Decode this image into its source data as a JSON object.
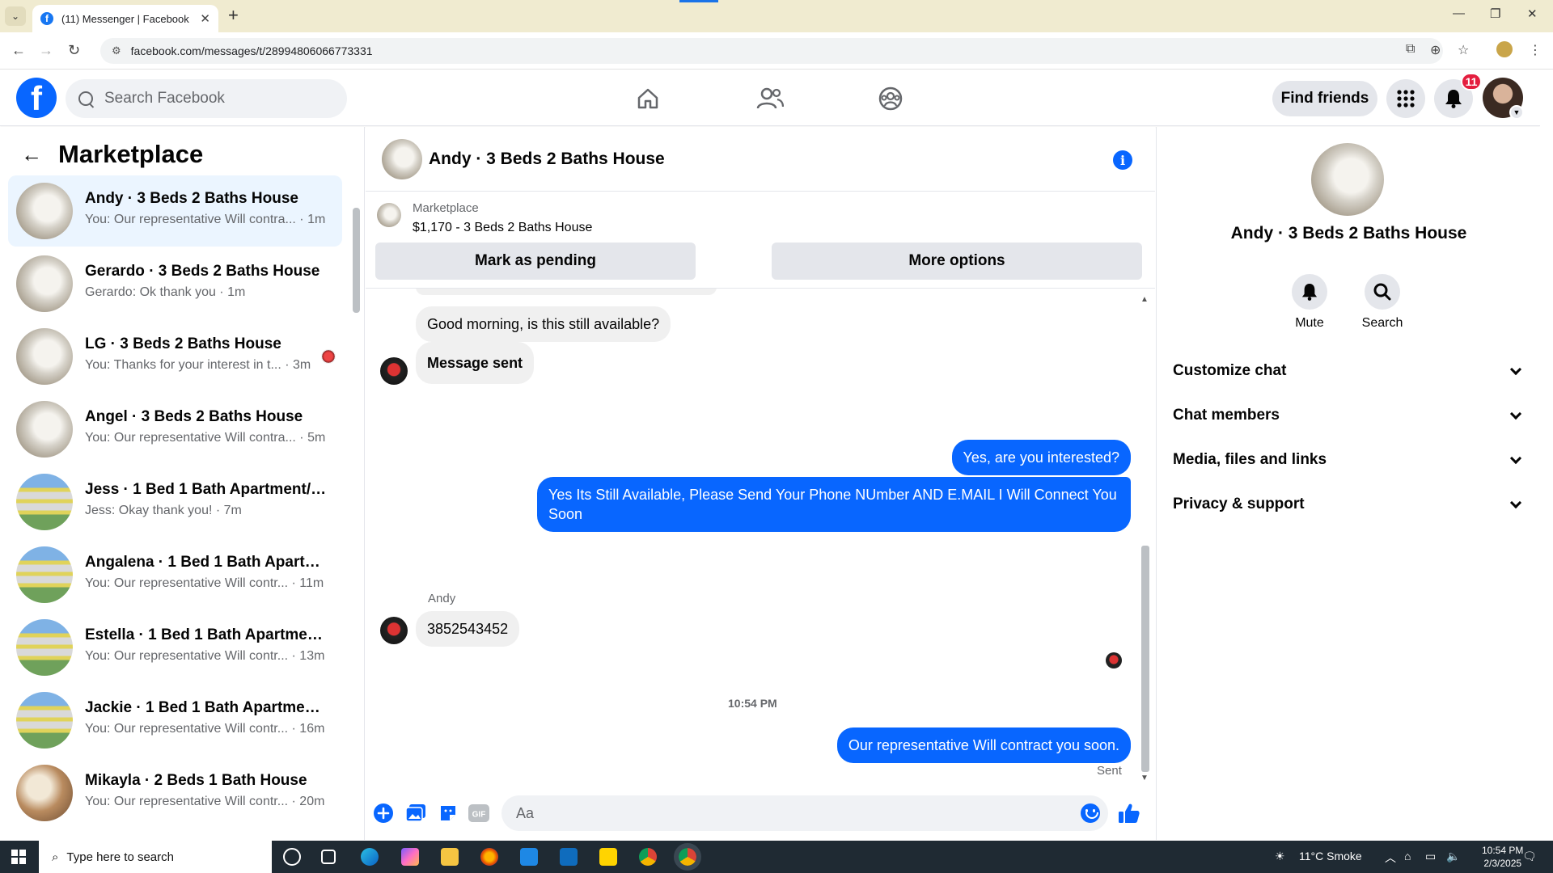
{
  "browser": {
    "tab_title": "(11) Messenger | Facebook",
    "url": "facebook.com/messages/t/28994806066773331"
  },
  "fb_header": {
    "search_placeholder": "Search Facebook",
    "find_friends": "Find friends",
    "notif_count": "11"
  },
  "sidebar": {
    "title": "Marketplace",
    "conversations": [
      {
        "name": "Andy · 3 Beds 2 Baths House",
        "snippet": "You: Our representative Will contra... · 1m",
        "thumb": "house",
        "active": true
      },
      {
        "name": "Gerardo · 3 Beds 2 Baths House",
        "snippet": "Gerardo: Ok thank you · 1m",
        "thumb": "house"
      },
      {
        "name": "LG · 3 Beds 2 Baths House",
        "snippet": "You: Thanks for your interest in t... · 3m",
        "thumb": "house",
        "seen": true
      },
      {
        "name": "Angel · 3 Beds 2 Baths House",
        "snippet": "You: Our representative Will contra... · 5m",
        "thumb": "house"
      },
      {
        "name": "Jess · 1 Bed 1 Bath Apartment/co...",
        "snippet": "Jess: Okay thank you! · 7m",
        "thumb": "apt"
      },
      {
        "name": "Angalena · 1 Bed 1 Bath Apartme...",
        "snippet": "You: Our representative Will contr... · 11m",
        "thumb": "apt"
      },
      {
        "name": "Estella · 1 Bed 1 Bath Apartment/...",
        "snippet": "You: Our representative Will contr... · 13m",
        "thumb": "apt"
      },
      {
        "name": "Jackie · 1 Bed 1 Bath Apartment/...",
        "snippet": "You: Our representative Will contr... · 16m",
        "thumb": "apt"
      },
      {
        "name": "Mikayla · 2 Beds 1 Bath House",
        "snippet": "You: Our representative Will contr... · 20m",
        "thumb": "bath"
      }
    ]
  },
  "chat": {
    "title": "Andy · 3 Beds 2 Baths House",
    "marketplace_label": "Marketplace",
    "listing": "$1,170 - 3 Beds 2 Baths House",
    "mark_pending": "Mark as pending",
    "more_options": "More options",
    "messages": {
      "m1": "Good morning, is this still available?",
      "m2": "Message sent",
      "m3": "Yes, are you interested?",
      "m4": "Yes Its Still Available, Please Send Your Phone NUmber AND E.MAIL I Will Connect You Soon",
      "sender": "Andy",
      "m5": "3852543452",
      "time": "10:54 PM",
      "m6": "Our representative Will contract you soon.",
      "status": "Sent"
    },
    "composer_placeholder": "Aa"
  },
  "info_panel": {
    "name": "Andy · 3 Beds 2 Baths House",
    "mute": "Mute",
    "search": "Search",
    "sections": [
      "Customize chat",
      "Chat members",
      "Media, files and links",
      "Privacy & support"
    ]
  },
  "taskbar": {
    "search_placeholder": "Type here to search",
    "weather": "11°C  Smoke",
    "time": "10:54 PM",
    "date": "2/3/2025",
    "notif": "1"
  }
}
